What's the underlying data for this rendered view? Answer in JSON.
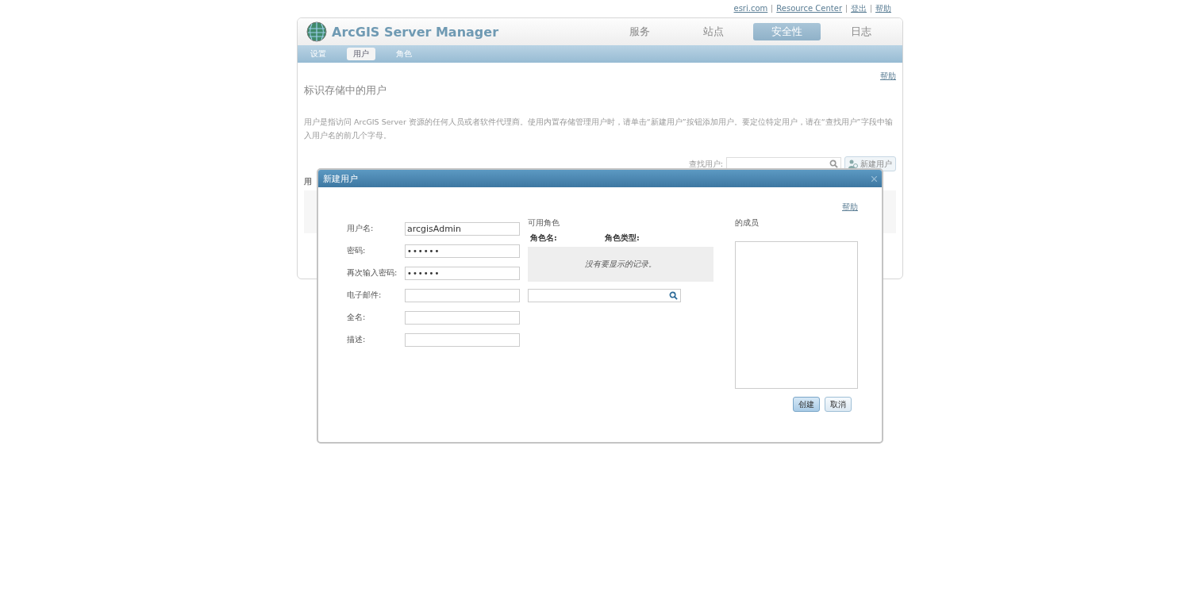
{
  "top_links": [
    "esri.com",
    "Resource Center",
    "登出",
    "帮助"
  ],
  "app": {
    "title": "ArcGIS Server Manager",
    "nav": [
      {
        "label": "服务",
        "selected": false
      },
      {
        "label": "站点",
        "selected": false
      },
      {
        "label": "安全性",
        "selected": true
      },
      {
        "label": "日志",
        "selected": false
      }
    ],
    "subnav": [
      {
        "label": "设置",
        "selected": false
      },
      {
        "label": "用户",
        "selected": true
      },
      {
        "label": "角色",
        "selected": false
      }
    ]
  },
  "page": {
    "help": "帮助",
    "heading": "标识存储中的用户",
    "description": "用户是指访问 ArcGIS Server 资源的任何人员或者软件代理商。使用内置存储管理用户时，请单击“新建用户”按钮添加用户。要定位特定用户，请在“查找用户”字段中输入用户名的前几个字母。",
    "search_label": "查找用户:",
    "new_user_button": "新建用户",
    "table_header": "用"
  },
  "dialog": {
    "title": "新建用户",
    "help": "帮助",
    "fields": [
      {
        "label": "用户名:",
        "value": "arcgisAdmin",
        "kind": "text"
      },
      {
        "label": "密码:",
        "value": "••••••",
        "kind": "password"
      },
      {
        "label": "再次输入密码:",
        "value": "••••••",
        "kind": "password"
      },
      {
        "label": "电子邮件:",
        "kind": "text"
      },
      {
        "label": "全名:",
        "kind": "text"
      },
      {
        "label": "描述:",
        "kind": "text"
      }
    ],
    "available_roles": {
      "title": "可用角色",
      "columns": [
        "角色名:",
        "角色类型:"
      ],
      "empty_message": "没有要显示的记录。"
    },
    "members_title": "的成员",
    "buttons": [
      {
        "label": "创建",
        "default": true
      },
      {
        "label": "取消",
        "default": false
      }
    ]
  }
}
